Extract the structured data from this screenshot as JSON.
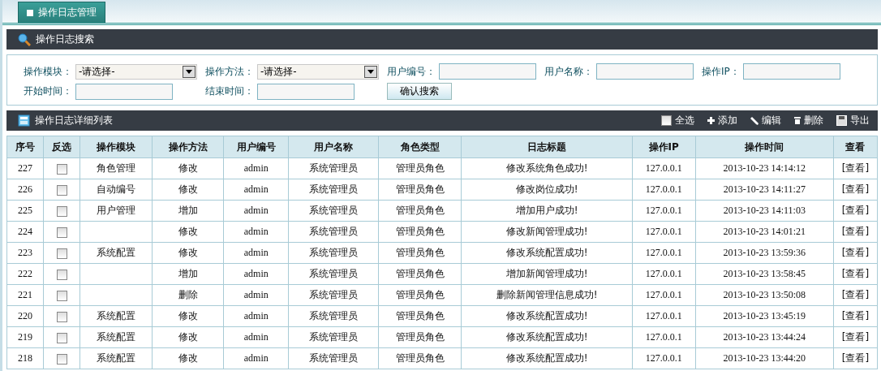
{
  "tab": {
    "label": "操作日志管理",
    "selected": true
  },
  "search_panel": {
    "title": "操作日志搜索",
    "fields": [
      {
        "kind": "select",
        "label": "操作模块：",
        "value": "-请选择-"
      },
      {
        "kind": "select",
        "label": "操作方法：",
        "value": "-请选择-"
      },
      {
        "kind": "text",
        "label": "用户编号："
      },
      {
        "kind": "text",
        "label": "用户名称："
      },
      {
        "kind": "text",
        "label": "操作IP："
      },
      {
        "kind": "text",
        "label": "开始时间："
      },
      {
        "kind": "text",
        "label": "结束时间："
      }
    ],
    "submit": "确认搜索"
  },
  "list_panel": {
    "title": "操作日志详细列表",
    "select_all": {
      "label": "全选",
      "checked": false
    },
    "actions": [
      {
        "kind": "add",
        "label": "添加"
      },
      {
        "kind": "edit",
        "label": "编辑"
      },
      {
        "kind": "delete",
        "label": "删除"
      },
      {
        "kind": "export",
        "label": "导出"
      }
    ]
  },
  "table": {
    "columns": [
      "序号",
      "反选",
      "操作模块",
      "操作方法",
      "用户编号",
      "用户名称",
      "角色类型",
      "日志标题",
      "操作IP",
      "操作时间",
      "查看"
    ],
    "rows": [
      {
        "id": "227",
        "checked": false,
        "module": "角色管理",
        "method": "修改",
        "user_id": "admin",
        "user_name": "系统管理员",
        "role": "管理员角色",
        "title": "修改系统角色成功!",
        "ip": "127.0.0.1",
        "time": "2013-10-23 14:14:12",
        "view": "[查看]"
      },
      {
        "id": "226",
        "checked": false,
        "module": "自动编号",
        "method": "修改",
        "user_id": "admin",
        "user_name": "系统管理员",
        "role": "管理员角色",
        "title": "修改岗位成功!",
        "ip": "127.0.0.1",
        "time": "2013-10-23 14:11:27",
        "view": "[查看]"
      },
      {
        "id": "225",
        "checked": false,
        "module": "用户管理",
        "method": "增加",
        "user_id": "admin",
        "user_name": "系统管理员",
        "role": "管理员角色",
        "title": "增加用户成功!",
        "ip": "127.0.0.1",
        "time": "2013-10-23 14:11:03",
        "view": "[查看]"
      },
      {
        "id": "224",
        "checked": false,
        "method": "修改",
        "user_id": "admin",
        "user_name": "系统管理员",
        "role": "管理员角色",
        "title": "修改新闻管理成功!",
        "ip": "127.0.0.1",
        "time": "2013-10-23 14:01:21",
        "view": "[查看]"
      },
      {
        "id": "223",
        "checked": false,
        "module": "系统配置",
        "method": "修改",
        "user_id": "admin",
        "user_name": "系统管理员",
        "role": "管理员角色",
        "title": "修改系统配置成功!",
        "ip": "127.0.0.1",
        "time": "2013-10-23 13:59:36",
        "view": "[查看]"
      },
      {
        "id": "222",
        "checked": false,
        "method": "增加",
        "user_id": "admin",
        "user_name": "系统管理员",
        "role": "管理员角色",
        "title": "增加新闻管理成功!",
        "ip": "127.0.0.1",
        "time": "2013-10-23 13:58:45",
        "view": "[查看]"
      },
      {
        "id": "221",
        "checked": false,
        "method": "删除",
        "user_id": "admin",
        "user_name": "系统管理员",
        "role": "管理员角色",
        "title": "删除新闻管理信息成功!",
        "ip": "127.0.0.1",
        "time": "2013-10-23 13:50:08",
        "view": "[查看]"
      },
      {
        "id": "220",
        "checked": false,
        "module": "系统配置",
        "method": "修改",
        "user_id": "admin",
        "user_name": "系统管理员",
        "role": "管理员角色",
        "title": "修改系统配置成功!",
        "ip": "127.0.0.1",
        "time": "2013-10-23 13:45:19",
        "view": "[查看]"
      },
      {
        "id": "219",
        "checked": false,
        "module": "系统配置",
        "method": "修改",
        "user_id": "admin",
        "user_name": "系统管理员",
        "role": "管理员角色",
        "title": "修改系统配置成功!",
        "ip": "127.0.0.1",
        "time": "2013-10-23 13:44:24",
        "view": "[查看]"
      },
      {
        "id": "218",
        "checked": false,
        "module": "系统配置",
        "method": "修改",
        "user_id": "admin",
        "user_name": "系统管理员",
        "role": "管理员角色",
        "title": "修改系统配置成功!",
        "ip": "127.0.0.1",
        "time": "2013-10-23 13:44:20",
        "view": "[查看]"
      }
    ]
  }
}
